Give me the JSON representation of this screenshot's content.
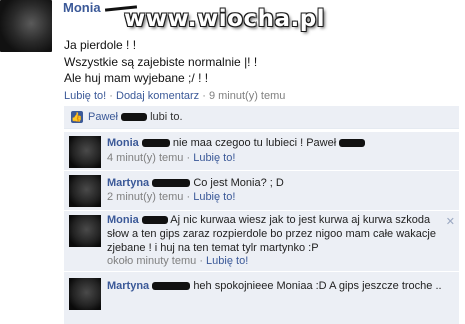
{
  "watermark": "www.wiocha.pl",
  "post": {
    "author": "Monia",
    "lines": [
      "Ja pierdole ! !",
      "Wszystkie są zajebiste normalnie |! !",
      "Ale huj mam wyjebane ;/ ! !"
    ],
    "like_link": "Lubię to!",
    "comment_link": "Dodaj komentarz",
    "time": "9 minut(y) temu",
    "separator": "·"
  },
  "likes": {
    "name": "Paweł",
    "text": "lubi to."
  },
  "comments": [
    {
      "author": "Monia",
      "text": "nie maa czegoo tu lubieci ! Paweł",
      "time": "4 minut(y) temu",
      "like": "Lubię to!"
    },
    {
      "author": "Martyna",
      "text": "Co jest Monia? ; D",
      "time": "2 minut(y) temu",
      "like": "Lubię to!"
    },
    {
      "author": "Monia",
      "text_l1": "Aj nic kurwaa wiesz jak to jest kurwa aj kurwa szkoda",
      "text_l2": "słow a ten gips zaraz rozpierdole bo przez nigoo mam całe wakacje",
      "text_l3": "zjebane ! i huj na ten temat tylr martynko :P",
      "time": "około minuty temu",
      "like": "Lubię to!",
      "close": "✕"
    },
    {
      "author": "Martyna",
      "text": "heh spokojnieee Moniaa :D A gips jeszcze troche .."
    }
  ]
}
